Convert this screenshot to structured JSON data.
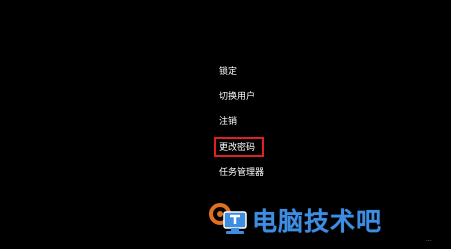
{
  "menu": {
    "items": [
      {
        "label": "锁定"
      },
      {
        "label": "切换用户"
      },
      {
        "label": "注销"
      },
      {
        "label": "更改密码"
      },
      {
        "label": "任务管理器"
      }
    ],
    "highlighted_item": "更改密码"
  },
  "watermark": {
    "brand_text": "电脑技术吧",
    "logo_icon": "computer-gear-logo-icon",
    "url_fragment": "..."
  },
  "colors": {
    "background": "#000000",
    "menu_text": "#ffffff",
    "highlight_border": "#e02020",
    "watermark_blue": "#3f8de0"
  }
}
